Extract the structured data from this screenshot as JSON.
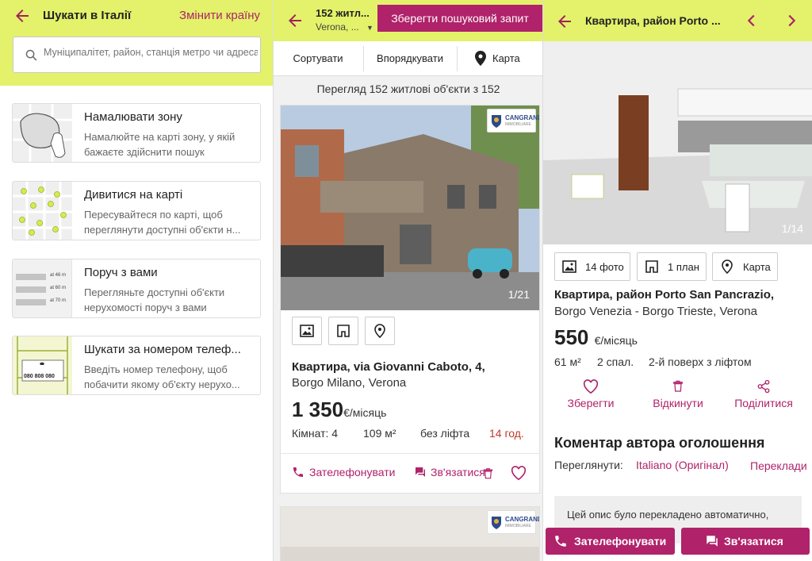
{
  "screen1": {
    "title": "Шукати в Італії",
    "change_country": "Змінити країну",
    "search_placeholder": "Муніципалітет, район, станція метро чи адреса",
    "options": [
      {
        "title": "Намалювати зону",
        "desc": "Намалюйте на карті зону, у якій бажаєте здійснити пошук"
      },
      {
        "title": "Дивитися на карті",
        "desc": "Пересувайтеся по карті, щоб переглянути доступні об'єкти н..."
      },
      {
        "title": "Поруч з вами",
        "desc": "Перегляньте доступні об'єкти нерухомості поруч з вами"
      },
      {
        "title": "Шукати за номером телеф...",
        "desc": "Введіть номер телефону, щоб побачити якому об'єкту нерухо..."
      }
    ],
    "distance_labels": [
      "at 46 m",
      "at 60 m",
      "at 70 m"
    ],
    "phone_sample": "080 808 080"
  },
  "screen2": {
    "count_short": "152 житл...",
    "location": "Verona, ...",
    "save_search": "Зберегти пошуковий запит",
    "sort_label": "Сортувати",
    "order_label": "Впорядкувати",
    "map_label": "Карта",
    "results_text": "Перегляд 152 житлові об'єкти з 152",
    "listing": {
      "photo_counter": "1/21",
      "agency_name": "CANGRANDE",
      "agency_sub": "IMMOBILIARE",
      "title": "Квартира, via Giovanni Caboto, 4,",
      "address": "Borgo Milano, Verona",
      "price": "1 350",
      "price_unit": "€/місяць",
      "rooms": "Кімнат: 4",
      "area": "109 м²",
      "lift": "без ліфта",
      "age": "14 год.",
      "call": "Зателефонувати",
      "contact": "Зв'язатися"
    }
  },
  "screen3": {
    "title": "Квартира, район Porto ...",
    "photo_counter": "1/14",
    "photos_btn": "14 фото",
    "plan_btn": "1 план",
    "map_btn": "Карта",
    "listing_title": "Квартира, район Porto San Pancrazio,",
    "address": "Borgo Venezia - Borgo Trieste, Verona",
    "price": "550",
    "price_unit": "€/місяць",
    "area": "61 м²",
    "bedrooms": "2 спал.",
    "floor": "2-й поверх з ліфтом",
    "save": "Зберегти",
    "discard": "Відкинути",
    "share": "Поділитися",
    "comment_title": "Коментар автора оголошення",
    "view_label": "Переглянути:",
    "original_lang": "Italiano (Оригінал)",
    "translate": "Переклади",
    "translation_note": "Цей опис було перекладено автоматично,",
    "call": "Зателефонувати",
    "contact": "Зв'язатися"
  },
  "colors": {
    "accent": "#b0226a",
    "header": "#e3f26a"
  }
}
